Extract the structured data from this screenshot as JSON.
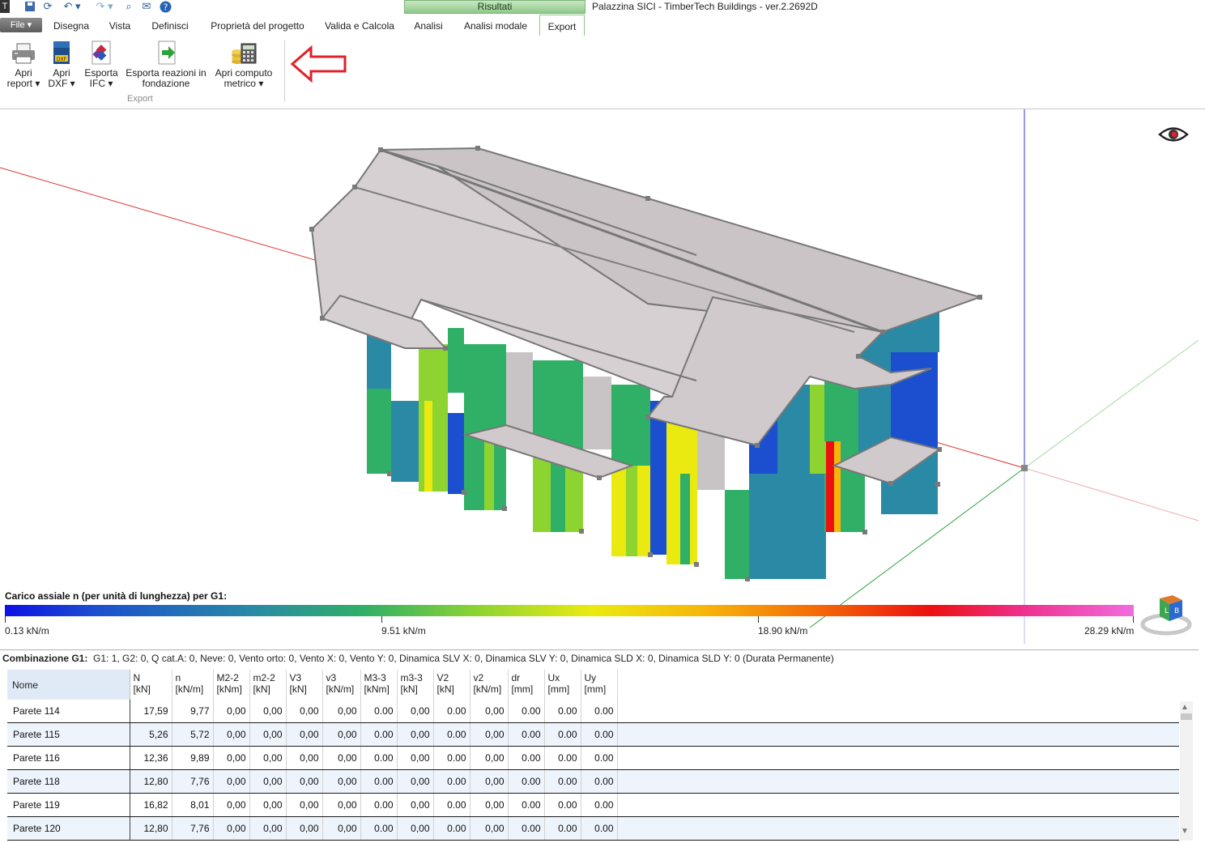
{
  "title": "Palazzina SICI - TimberTech Buildings - ver.2.2692D",
  "context_tab": "Risultati",
  "file_label": "File",
  "tabs": [
    {
      "label": "Disegna"
    },
    {
      "label": "Vista"
    },
    {
      "label": "Definisci"
    },
    {
      "label": "Proprietà del progetto"
    },
    {
      "label": "Valida e Calcola"
    },
    {
      "label": "Analisi"
    },
    {
      "label": "Analisi modale"
    },
    {
      "label": "Export",
      "active": true
    }
  ],
  "ribbon": {
    "buttons": [
      {
        "line1": "Apri",
        "line2": "report ▾",
        "icon": "printer-icon"
      },
      {
        "line1": "Apri",
        "line2": "DXF ▾",
        "icon": "dxf-file-icon"
      },
      {
        "line1": "Esporta",
        "line2": "IFC ▾",
        "icon": "ifc-icon"
      },
      {
        "line1": "Esporta reazioni in",
        "line2": "fondazione",
        "icon": "export-arrow-icon"
      },
      {
        "line1": "Apri computo",
        "line2": "metrico ▾",
        "icon": "calculator-coins-icon"
      }
    ],
    "group_label": "Export"
  },
  "legend": {
    "title": "Carico assiale n (per unità di lunghezza) per G1:",
    "ticks": [
      "0.13 kN/m",
      "9.51 kN/m",
      "18.90 kN/m",
      "28.29 kN/m"
    ]
  },
  "combination": {
    "label": "Combinazione G1:",
    "text": "G1: 1, G2: 0, Q cat.A: 0, Neve: 0, Vento orto: 0, Vento X: 0, Vento Y: 0, Dinamica SLV X: 0, Dinamica SLV Y: 0, Dinamica SLD X: 0, Dinamica SLD Y: 0 (Durata Permanente)"
  },
  "table": {
    "columns": [
      {
        "name": "Nome",
        "unit": ""
      },
      {
        "name": "N",
        "unit": "[kN]"
      },
      {
        "name": "n",
        "unit": "[kN/m]"
      },
      {
        "name": "M2-2",
        "unit": "[kNm]"
      },
      {
        "name": "m2-2",
        "unit": "[kN]"
      },
      {
        "name": "V3",
        "unit": "[kN]"
      },
      {
        "name": "v3",
        "unit": "[kN/m]"
      },
      {
        "name": "M3-3",
        "unit": "[kNm]"
      },
      {
        "name": "m3-3",
        "unit": "[kN]"
      },
      {
        "name": "V2",
        "unit": "[kN]"
      },
      {
        "name": "v2",
        "unit": "[kN/m]"
      },
      {
        "name": "dr",
        "unit": "[mm]"
      },
      {
        "name": "Ux",
        "unit": "[mm]"
      },
      {
        "name": "Uy",
        "unit": "[mm]"
      }
    ],
    "rows": [
      [
        "Parete 114",
        "17,59",
        "9,77",
        "0,00",
        "0,00",
        "0,00",
        "0,00",
        "0.00",
        "0,00",
        "0.00",
        "0,00",
        "0.00",
        "0.00",
        "0.00"
      ],
      [
        "Parete 115",
        "5,26",
        "5,72",
        "0,00",
        "0,00",
        "0,00",
        "0,00",
        "0.00",
        "0,00",
        "0.00",
        "0,00",
        "0.00",
        "0.00",
        "0.00"
      ],
      [
        "Parete 116",
        "12,36",
        "9,89",
        "0,00",
        "0,00",
        "0,00",
        "0,00",
        "0.00",
        "0,00",
        "0.00",
        "0,00",
        "0.00",
        "0.00",
        "0.00"
      ],
      [
        "Parete 118",
        "12,80",
        "7,76",
        "0,00",
        "0,00",
        "0,00",
        "0,00",
        "0.00",
        "0,00",
        "0.00",
        "0,00",
        "0.00",
        "0.00",
        "0.00"
      ],
      [
        "Parete 119",
        "16,82",
        "8,01",
        "0,00",
        "0,00",
        "0,00",
        "0,00",
        "0.00",
        "0,00",
        "0.00",
        "0,00",
        "0.00",
        "0.00",
        "0.00"
      ],
      [
        "Parete 120",
        "12,80",
        "7,76",
        "0,00",
        "0,00",
        "0,00",
        "0,00",
        "0.00",
        "0,00",
        "0.00",
        "0,00",
        "0.00",
        "0.00",
        "0.00"
      ]
    ]
  },
  "colors": {
    "accent_green": "#8fc88a",
    "arrow_red": "#e0202a",
    "row_alt": "#eef4fc"
  }
}
